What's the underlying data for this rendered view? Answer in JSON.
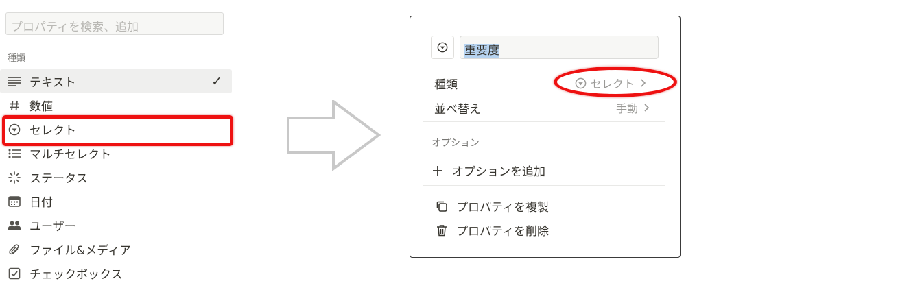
{
  "left_panel": {
    "search_placeholder": "プロパティを検索、追加",
    "section_label": "種類",
    "types": [
      {
        "label": "テキスト",
        "icon": "text-lines-icon",
        "selected": true
      },
      {
        "label": "数値",
        "icon": "hash-icon"
      },
      {
        "label": "セレクト",
        "icon": "select-circle-icon"
      },
      {
        "label": "マルチセレクト",
        "icon": "bulleted-list-icon"
      },
      {
        "label": "ステータス",
        "icon": "status-spinner-icon"
      },
      {
        "label": "日付",
        "icon": "calendar-icon"
      },
      {
        "label": "ユーザー",
        "icon": "users-icon"
      },
      {
        "label": "ファイル&メディア",
        "icon": "paperclip-icon"
      },
      {
        "label": "チェックボックス",
        "icon": "checkbox-icon"
      }
    ],
    "check_mark": "✓"
  },
  "right_panel": {
    "property_name": "重要度",
    "type_label": "種類",
    "type_value": "セレクト",
    "sort_label": "並べ替え",
    "sort_value": "手動",
    "options_label": "オプション",
    "add_option": "オプションを追加",
    "duplicate_property": "プロパティを複製",
    "delete_property": "プロパティを削除"
  },
  "colors": {
    "highlight_red": "#ee1111",
    "selection_blue": "#b6d3f0",
    "arrow_gray": "#c8c8c8"
  }
}
